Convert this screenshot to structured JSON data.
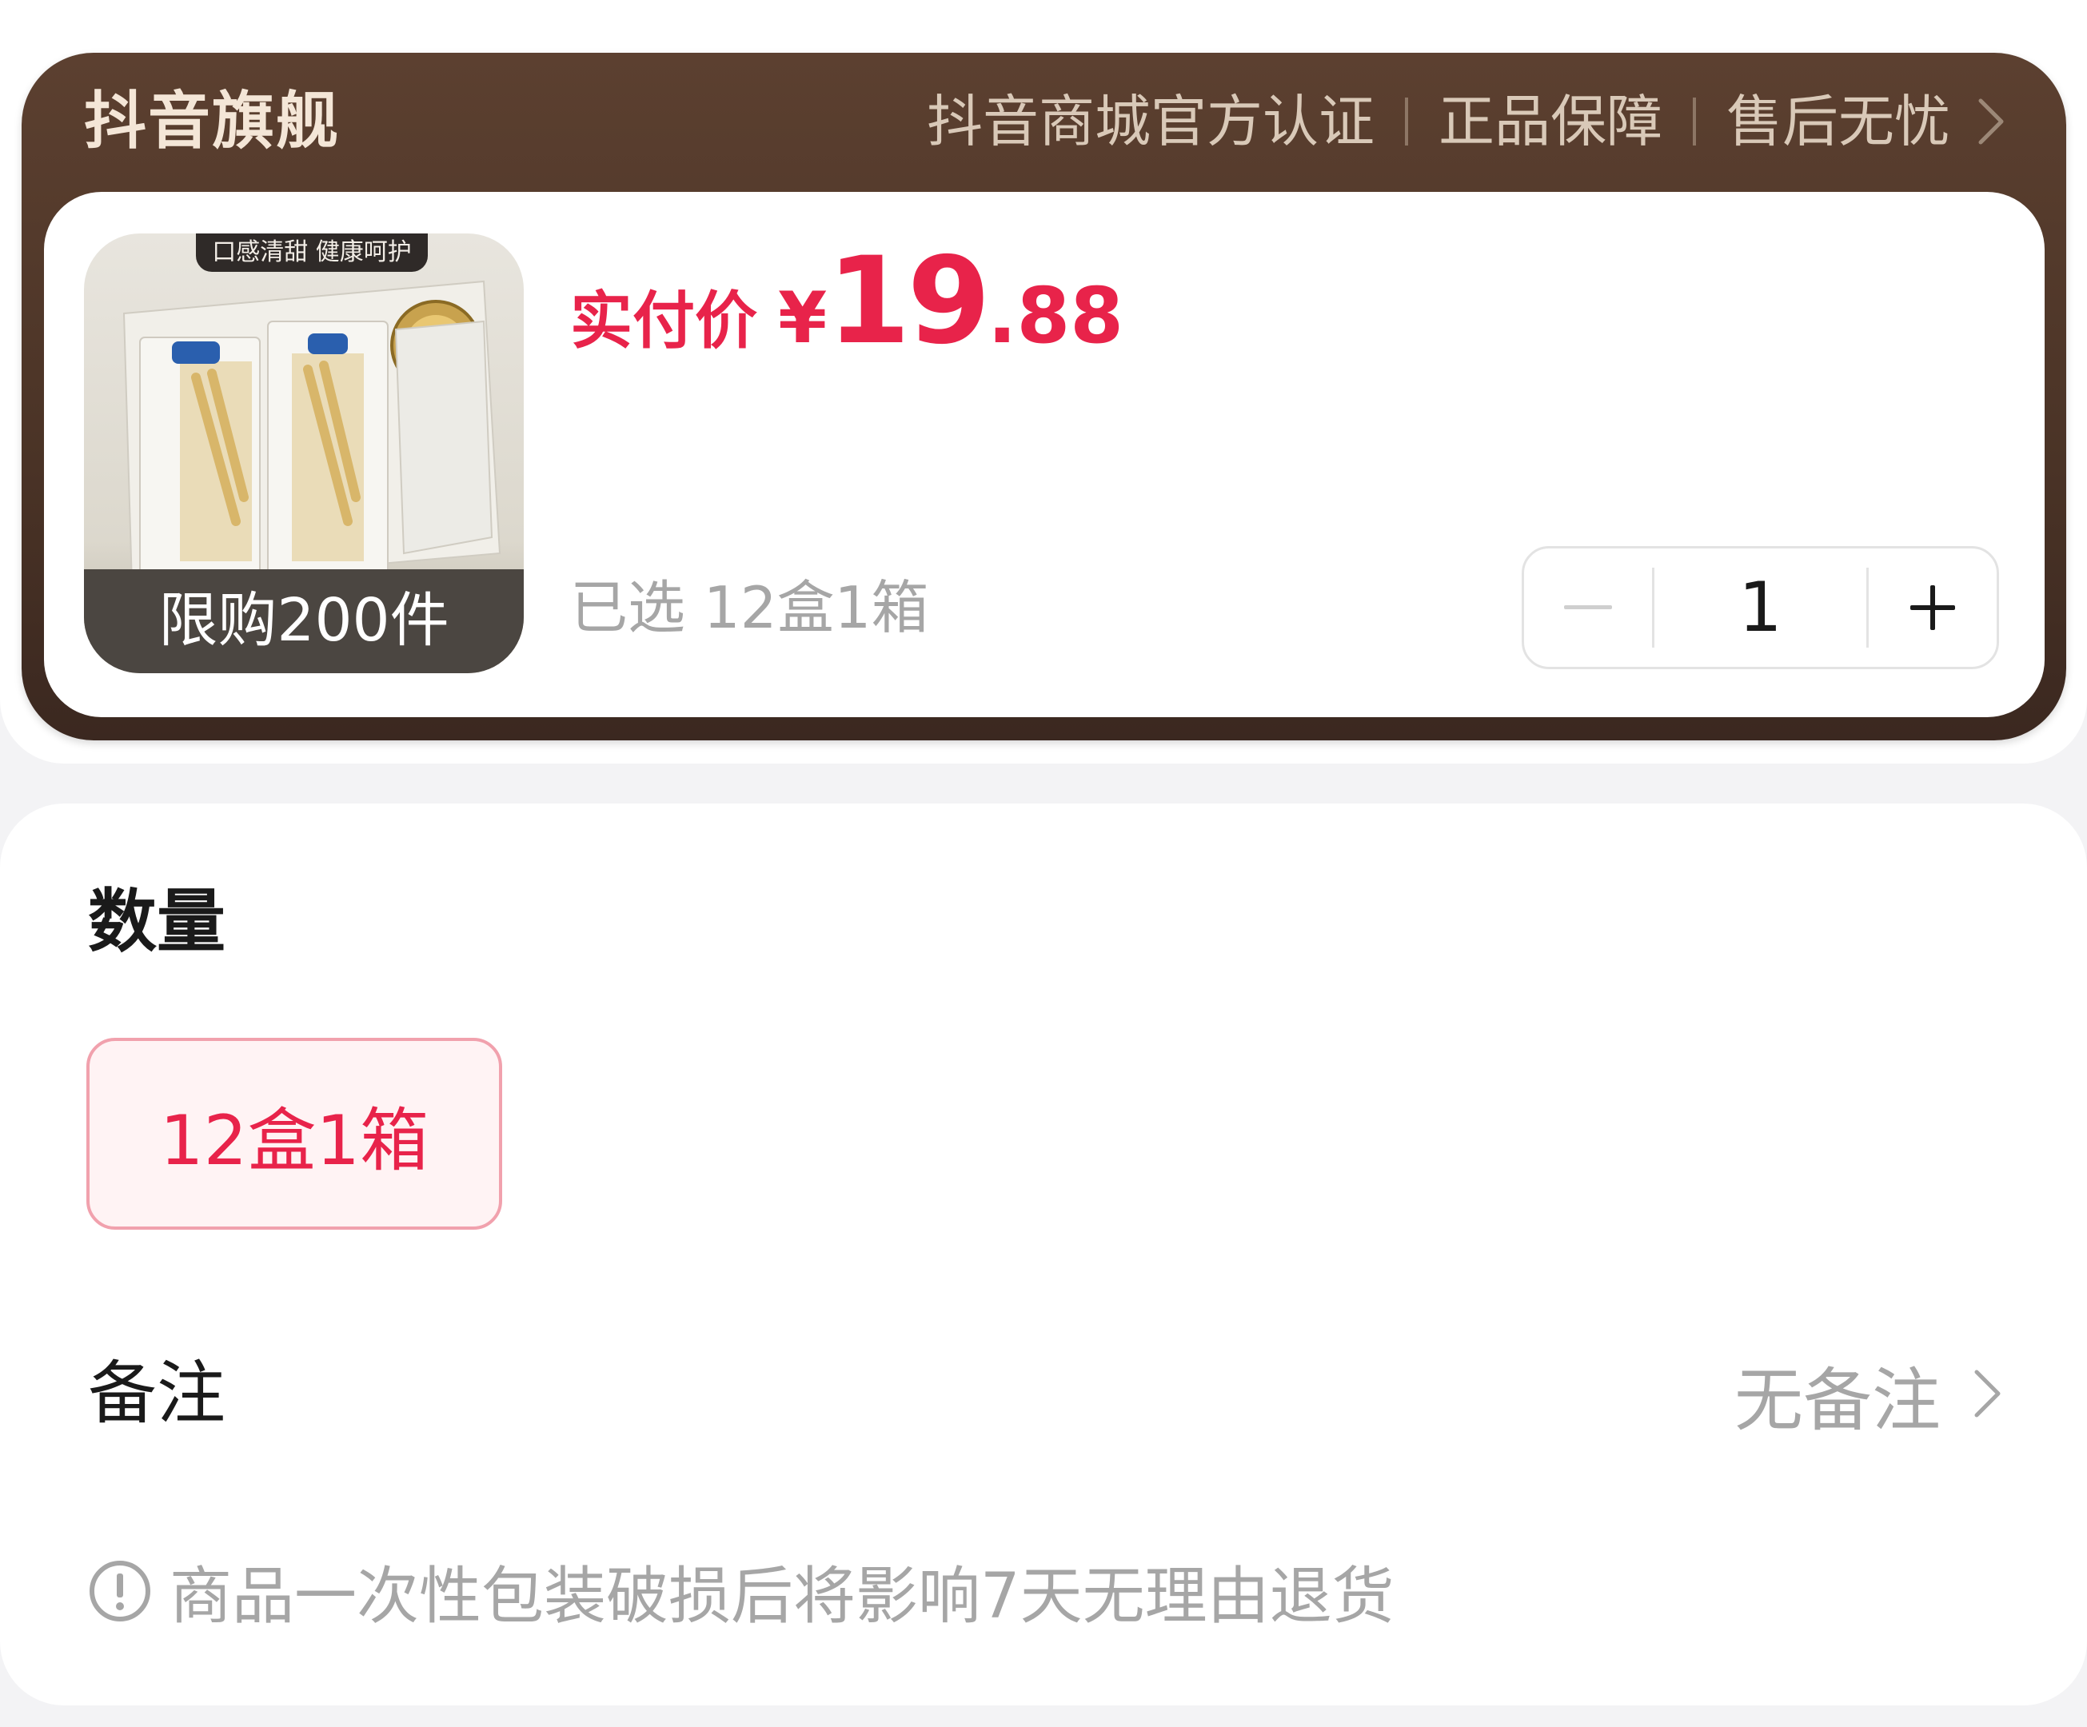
{
  "store": {
    "name": "抖音旗舰",
    "guarantees": [
      "抖音商城官方认证",
      "正品保障",
      "售后无忧"
    ],
    "chevron_icon": "chevron-right-icon"
  },
  "product": {
    "image_ribbon": "口感清甜 健康呵护",
    "limit_label": "限购200件",
    "price_label": "实付价",
    "price_currency": "¥",
    "price_int": "19",
    "price_dec": ".88",
    "selected_text": "已选 12盒1箱",
    "quantity": "1",
    "minus_icon": "minus-icon",
    "plus_icon": "plus-icon"
  },
  "options": {
    "title": "数量",
    "items": [
      {
        "label": "12盒1箱",
        "selected": true
      }
    ]
  },
  "remark": {
    "label": "备注",
    "value": "无备注"
  },
  "notice": {
    "icon": "info-icon",
    "text": "商品一次性包装破损后将影响7天无理由退货"
  },
  "colors": {
    "accent": "#e8234a",
    "header_bg": "#4a3326",
    "muted": "#a6a6a6"
  }
}
